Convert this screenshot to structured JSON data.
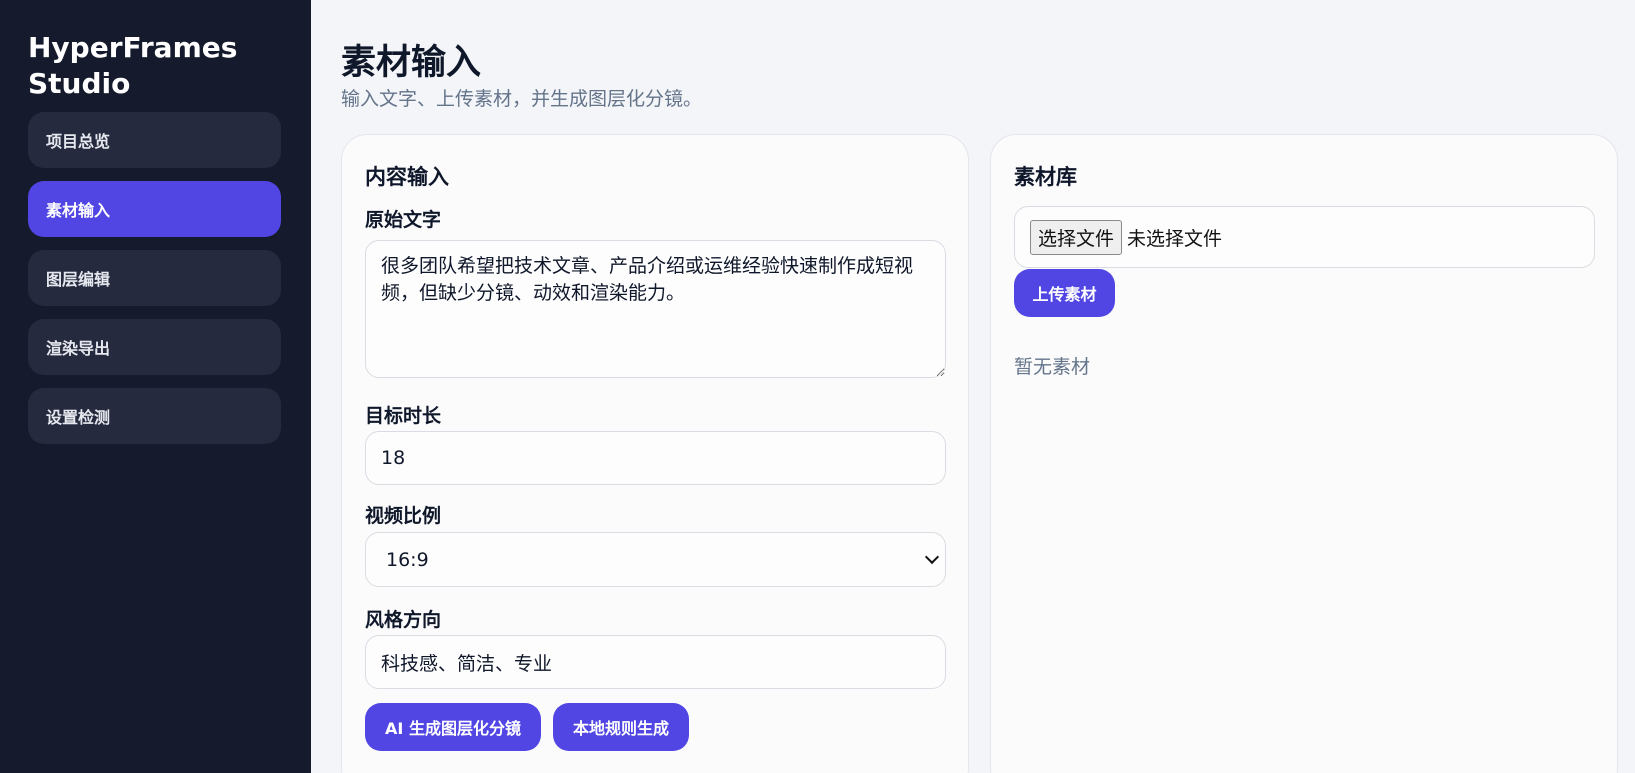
{
  "sidebar": {
    "brand": "HyperFrames Studio",
    "items": [
      {
        "label": "项目总览",
        "active": false
      },
      {
        "label": "素材输入",
        "active": true
      },
      {
        "label": "图层编辑",
        "active": false
      },
      {
        "label": "渲染导出",
        "active": false
      },
      {
        "label": "设置检测",
        "active": false
      }
    ]
  },
  "header": {
    "title": "素材输入",
    "subtitle": "输入文字、上传素材，并生成图层化分镜。"
  },
  "content_card": {
    "title": "内容输入",
    "source_text": {
      "label": "原始文字",
      "value": "很多团队希望把技术文章、产品介绍或运维经验快速制作成短视频，但缺少分镜、动效和渲染能力。"
    },
    "duration": {
      "label": "目标时长",
      "value": "18"
    },
    "ratio": {
      "label": "视频比例",
      "value": "16:9"
    },
    "style": {
      "label": "风格方向",
      "value": "科技感、简洁、专业"
    },
    "buttons": {
      "ai_generate": "AI 生成图层化分镜",
      "local_generate": "本地规则生成"
    }
  },
  "library_card": {
    "title": "素材库",
    "file_button": "选择文件",
    "file_status": "未选择文件",
    "upload_button": "上传素材",
    "empty_text": "暂无素材"
  },
  "colors": {
    "sidebar_bg": "#151a2d",
    "accent": "#5146e3",
    "nav_item_bg": "#262a3e"
  }
}
